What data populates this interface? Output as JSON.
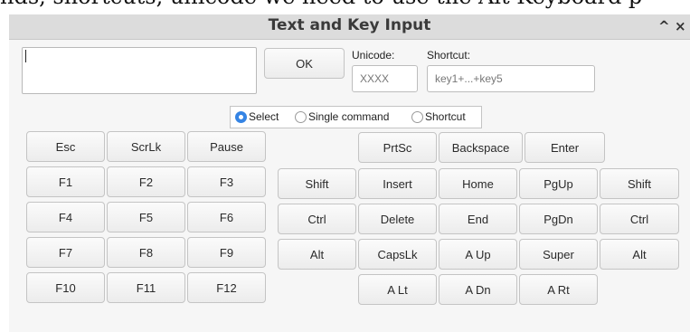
{
  "background_text": "nds, shortcuts, unicode we need to use the Alt Keyboard p",
  "window": {
    "title": "Text and Key Input",
    "minimize_glyph": "^",
    "close_glyph": "×"
  },
  "ok_label": "OK",
  "unicode": {
    "label": "Unicode:",
    "placeholder": "XXXX"
  },
  "shortcut": {
    "label": "Shortcut:",
    "placeholder": "key1+...+key5"
  },
  "modes": [
    {
      "label": "Select",
      "selected": true
    },
    {
      "label": "Single command",
      "selected": false
    },
    {
      "label": "Shortcut",
      "selected": false
    }
  ],
  "keys": {
    "esc": "Esc",
    "scrlk": "ScrLk",
    "pause": "Pause",
    "prtsc": "PrtSc",
    "backspace": "Backspace",
    "enter": "Enter",
    "f1": "F1",
    "f2": "F2",
    "f3": "F3",
    "f4": "F4",
    "f5": "F5",
    "f6": "F6",
    "f7": "F7",
    "f8": "F8",
    "f9": "F9",
    "f10": "F10",
    "f11": "F11",
    "f12": "F12",
    "shift_left": "Shift",
    "insert": "Insert",
    "home": "Home",
    "pgup": "PgUp",
    "shift_right": "Shift",
    "ctrl_left": "Ctrl",
    "delete": "Delete",
    "end": "End",
    "pgdn": "PgDn",
    "ctrl_right": "Ctrl",
    "alt_left": "Alt",
    "capslk": "CapsLk",
    "a_up": "A Up",
    "super": "Super",
    "alt_right": "Alt",
    "a_lt": "A Lt",
    "a_dn": "A Dn",
    "a_rt": "A Rt"
  },
  "colors": {
    "accent": "#3584e4",
    "titlebar": "#dcdcdc"
  }
}
